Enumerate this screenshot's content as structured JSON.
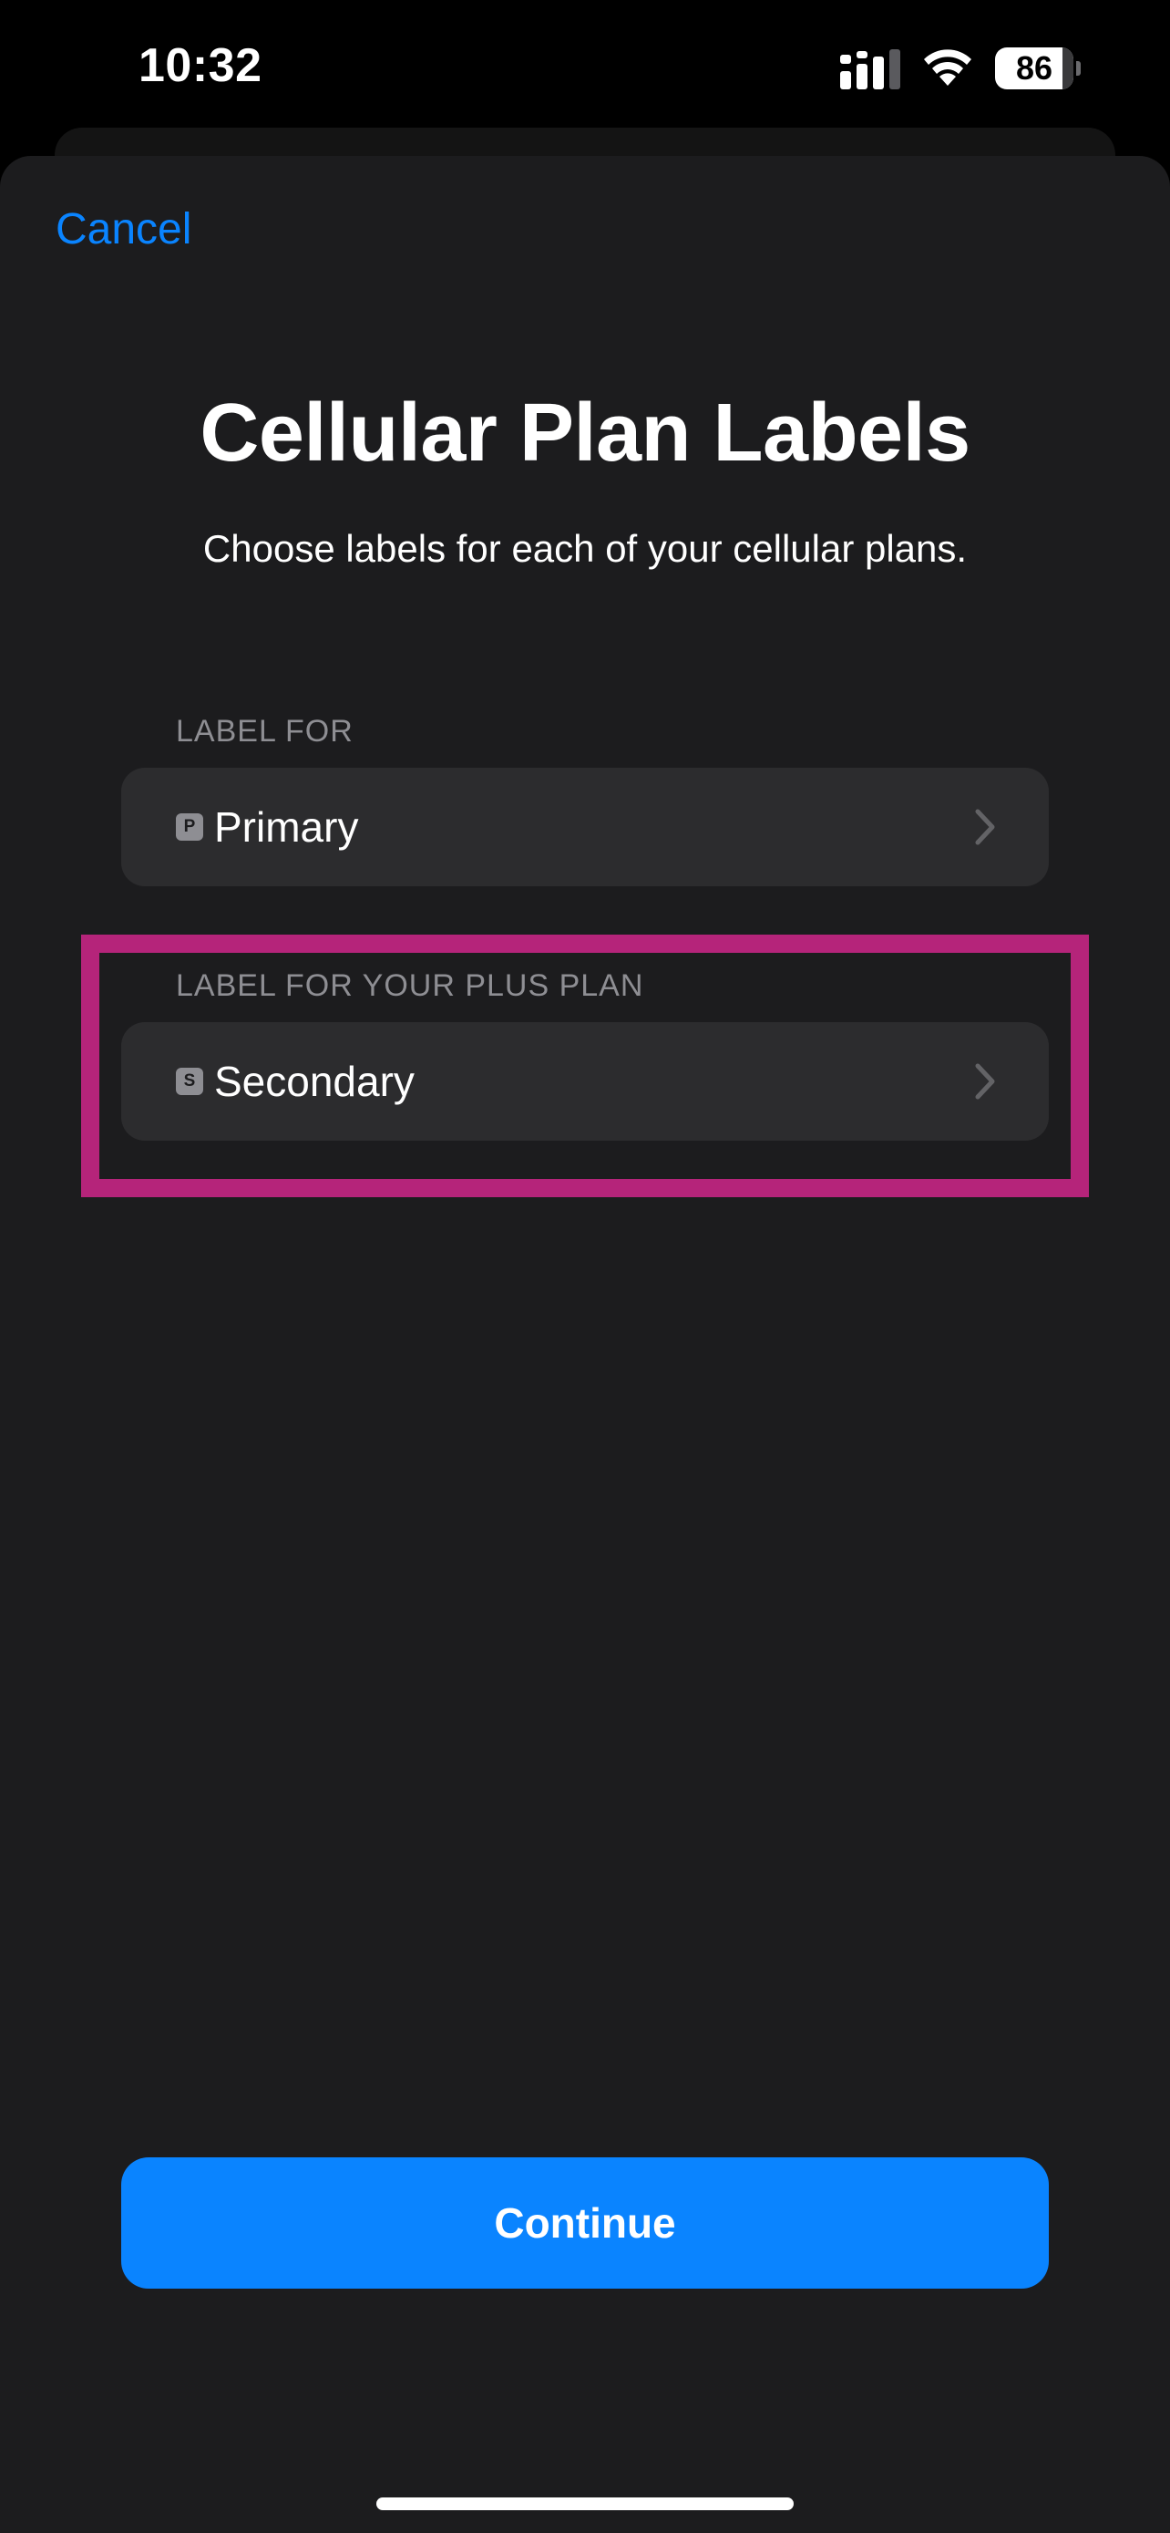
{
  "status_bar": {
    "time": "10:32",
    "battery_level": "86"
  },
  "sheet": {
    "cancel_label": "Cancel",
    "title": "Cellular Plan Labels",
    "subtitle": "Choose labels for each of your cellular plans."
  },
  "plans": [
    {
      "section_header": "LABEL FOR",
      "badge": "P",
      "label": "Primary"
    },
    {
      "section_header": "LABEL FOR YOUR PLUS PLAN",
      "badge": "S",
      "label": "Secondary"
    }
  ],
  "continue_label": "Continue",
  "colors": {
    "accent": "#0a84ff",
    "background": "#1c1c1e",
    "row_background": "#2c2c2e",
    "secondary_text": "#8e8e93",
    "highlight": "#b5247a"
  },
  "icons": {
    "signal": "cellular-signal-icon",
    "wifi": "wifi-icon",
    "battery": "battery-icon",
    "chevron": "chevron-right-icon"
  }
}
